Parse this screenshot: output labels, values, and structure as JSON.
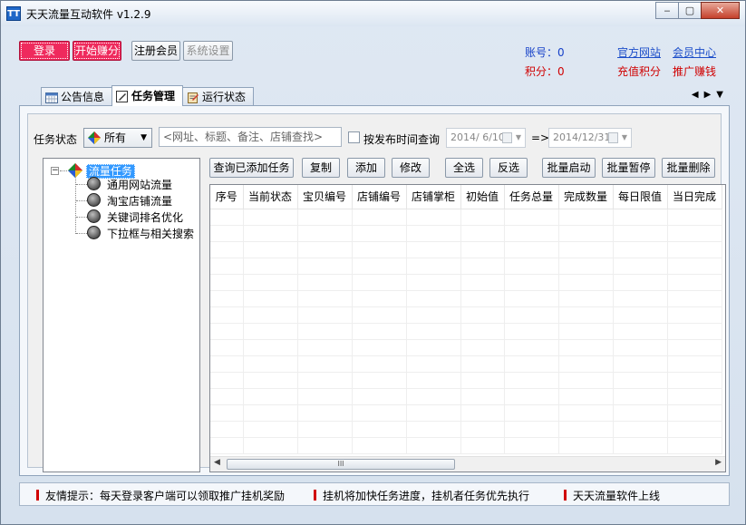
{
  "window": {
    "title": "天天流量互动软件 v1.2.9",
    "icon_text": "TT"
  },
  "window_controls": {
    "minimize": "‒",
    "maximize": "▢",
    "close": "✕"
  },
  "toolbar": {
    "login": "登录",
    "start_earning": "开始赚分",
    "register": "注册会员",
    "settings": "系统设置"
  },
  "account": {
    "account_label": "账号：",
    "account_value": "0",
    "points_label": "积分：",
    "points_value": "0"
  },
  "links": {
    "official_site": "官方网站",
    "member_center": "会员中心",
    "recharge": "充值积分",
    "promote": "推广赚钱"
  },
  "tabs": [
    {
      "label": "公告信息",
      "icon": "calendar-icon"
    },
    {
      "label": "任务管理",
      "icon": "edit-icon"
    },
    {
      "label": "运行状态",
      "icon": "clipboard-icon"
    }
  ],
  "nav": {
    "prev": "◀",
    "next": "▶",
    "menu": "▼"
  },
  "filter": {
    "status_label": "任务状态",
    "status_value": "所有",
    "search_placeholder": "<网址、标题、备注、店铺查找>",
    "publish_time_label": "按发布时间查询",
    "date_from": "2014/ 6/10",
    "arrow": "=>",
    "date_to": "2014/12/31"
  },
  "tree": {
    "root": "流量任务",
    "children": [
      "通用网站流量",
      "淘宝店铺流量",
      "关键词排名优化",
      "下拉框与相关搜索"
    ]
  },
  "actions": {
    "query_added": "查询已添加任务",
    "copy": "复制",
    "add": "添加",
    "edit": "修改",
    "select_all": "全选",
    "invert": "反选",
    "batch_start": "批量启动",
    "batch_pause": "批量暂停",
    "batch_delete": "批量删除"
  },
  "table": {
    "columns": [
      "序号",
      "当前状态",
      "宝贝编号",
      "店铺编号",
      "店铺掌柜",
      "初始值",
      "任务总量",
      "完成数量",
      "每日限值",
      "当日完成"
    ],
    "rows": []
  },
  "scrollbar": {
    "thumb_grip": "III",
    "left": "◀",
    "right": "▶"
  },
  "status_bar": [
    "友情提示：每天登录客户端可以领取推广挂机奖励",
    "挂机将加快任务进度，挂机者任务优先执行",
    "天天流量软件上线"
  ],
  "colors": {
    "accent_red": "#ef2a5d",
    "link_blue": "#1c4ec9",
    "promo_red": "#d00000",
    "selection": "#3399ff"
  }
}
